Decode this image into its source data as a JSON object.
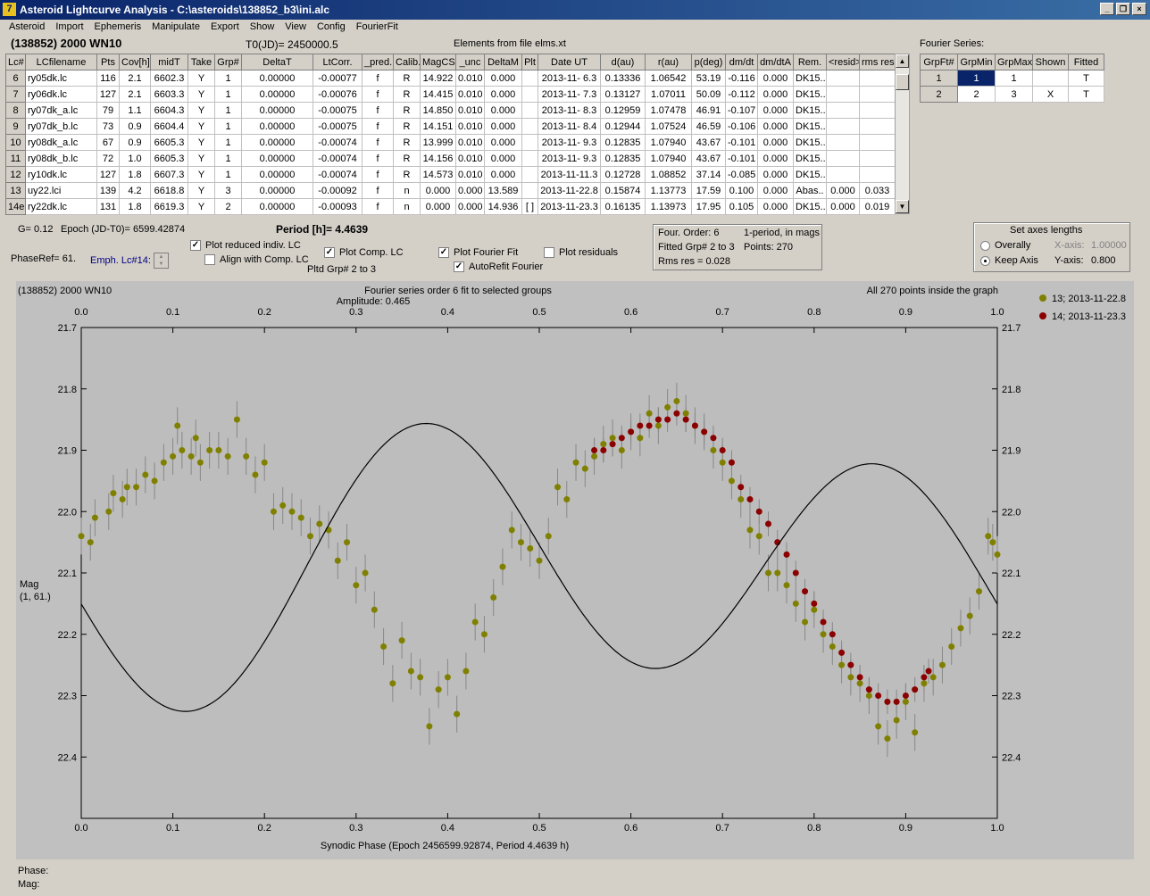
{
  "window": {
    "title": "Asteroid Lightcurve Analysis - C:\\asteroids\\138852_b3\\ini.alc",
    "icon_glyph": "7"
  },
  "menu": [
    "Asteroid",
    "Import",
    "Ephemeris",
    "Manipulate",
    "Export",
    "Show",
    "View",
    "Config",
    "FourierFit"
  ],
  "header": {
    "object": "(138852) 2000 WN10",
    "t0": "T0(JD)= 2450000.5",
    "elements": "Elements from file elms.xt"
  },
  "lc_table": {
    "columns": [
      "Lc#",
      "LCfilename",
      "Pts",
      "Cov[h]",
      "midT",
      "Take",
      "Grp#",
      "DeltaT",
      "LtCorr.",
      "_pred.",
      "Calib.",
      "MagCS",
      "_unc",
      "DeltaM",
      "Plt",
      "Date UT",
      "d(au)",
      "r(au)",
      "p(deg)",
      "dm/dt",
      "dm/dtA",
      "Rem.",
      "<resid>",
      "rms res"
    ],
    "rows": [
      [
        "6",
        "ry05dk.lc",
        "116",
        "2.1",
        "6602.3",
        "Y",
        "1",
        "0.00000",
        "-0.00077",
        "f",
        "R",
        "14.922",
        "0.010",
        "0.000",
        "",
        "2013-11- 6.3",
        "0.13336",
        "1.06542",
        "53.19",
        "-0.116",
        "0.000",
        "DK15..",
        "",
        ""
      ],
      [
        "7",
        "ry06dk.lc",
        "127",
        "2.1",
        "6603.3",
        "Y",
        "1",
        "0.00000",
        "-0.00076",
        "f",
        "R",
        "14.415",
        "0.010",
        "0.000",
        "",
        "2013-11- 7.3",
        "0.13127",
        "1.07011",
        "50.09",
        "-0.112",
        "0.000",
        "DK15..",
        "",
        ""
      ],
      [
        "8",
        "ry07dk_a.lc",
        "79",
        "1.1",
        "6604.3",
        "Y",
        "1",
        "0.00000",
        "-0.00075",
        "f",
        "R",
        "14.850",
        "0.010",
        "0.000",
        "",
        "2013-11- 8.3",
        "0.12959",
        "1.07478",
        "46.91",
        "-0.107",
        "0.000",
        "DK15..",
        "",
        ""
      ],
      [
        "9",
        "ry07dk_b.lc",
        "73",
        "0.9",
        "6604.4",
        "Y",
        "1",
        "0.00000",
        "-0.00075",
        "f",
        "R",
        "14.151",
        "0.010",
        "0.000",
        "",
        "2013-11- 8.4",
        "0.12944",
        "1.07524",
        "46.59",
        "-0.106",
        "0.000",
        "DK15..",
        "",
        ""
      ],
      [
        "10",
        "ry08dk_a.lc",
        "67",
        "0.9",
        "6605.3",
        "Y",
        "1",
        "0.00000",
        "-0.00074",
        "f",
        "R",
        "13.999",
        "0.010",
        "0.000",
        "",
        "2013-11- 9.3",
        "0.12835",
        "1.07940",
        "43.67",
        "-0.101",
        "0.000",
        "DK15..",
        "",
        ""
      ],
      [
        "11",
        "ry08dk_b.lc",
        "72",
        "1.0",
        "6605.3",
        "Y",
        "1",
        "0.00000",
        "-0.00074",
        "f",
        "R",
        "14.156",
        "0.010",
        "0.000",
        "",
        "2013-11- 9.3",
        "0.12835",
        "1.07940",
        "43.67",
        "-0.101",
        "0.000",
        "DK15..",
        "",
        ""
      ],
      [
        "12",
        "ry10dk.lc",
        "127",
        "1.8",
        "6607.3",
        "Y",
        "1",
        "0.00000",
        "-0.00074",
        "f",
        "R",
        "14.573",
        "0.010",
        "0.000",
        "",
        "2013-11-11.3",
        "0.12728",
        "1.08852",
        "37.14",
        "-0.085",
        "0.000",
        "DK15..",
        "",
        ""
      ],
      [
        "13",
        "uy22.lci",
        "139",
        "4.2",
        "6618.8",
        "Y",
        "3",
        "0.00000",
        "-0.00092",
        "f",
        "n",
        "0.000",
        "0.000",
        "13.589",
        "",
        "2013-11-22.8",
        "0.15874",
        "1.13773",
        "17.59",
        "0.100",
        "0.000",
        "Abas..",
        "0.000",
        "0.033"
      ],
      [
        "14e",
        "ry22dk.lc",
        "131",
        "1.8",
        "6619.3",
        "Y",
        "2",
        "0.00000",
        "-0.00093",
        "f",
        "n",
        "0.000",
        "0.000",
        "14.936",
        "[ ]",
        "2013-11-23.3",
        "0.16135",
        "1.13973",
        "17.95",
        "0.105",
        "0.000",
        "DK15..",
        "0.000",
        "0.019"
      ]
    ]
  },
  "fourier_table": {
    "title": "Fourier Series:",
    "columns": [
      "GrpFt#",
      "GrpMin",
      "GrpMax",
      "Shown",
      "Fitted"
    ],
    "rows": [
      [
        "1",
        "1",
        "1",
        "",
        "T"
      ],
      [
        "2",
        "2",
        "3",
        "X",
        "T"
      ]
    ]
  },
  "controls": {
    "g": "G= 0.12",
    "epoch": "Epoch (JD-T0)= 6599.42874",
    "period": "Period [h]= 4.4639",
    "phaseref": "PhaseRef= 61.",
    "emph": "Emph. Lc#14:",
    "plot_reduced": "Plot reduced indiv. LC",
    "align": "Align with Comp. LC",
    "plot_comp": "Plot Comp. LC",
    "pltd_grp": "Pltd Grp#  2  to   3",
    "plot_fourier": "Plot Fourier Fit",
    "autorefit": "AutoRefit Fourier",
    "plot_residuals": "Plot residuals"
  },
  "info": {
    "four_order": "Four. Order:  6",
    "mode": "1-period, in mags",
    "fitted": "Fitted Grp# 2 to 3",
    "points": "Points: 270",
    "rms": "Rms res     = 0.028"
  },
  "axes_box": {
    "title": "Set axes lengths",
    "overall": "Overally",
    "keep": "Keep Axis",
    "xlabel": "X-axis:",
    "xval": "1.00000",
    "ylabel": "Y-axis:",
    "yval": "0.800"
  },
  "status": {
    "phase": "Phase:",
    "mag": "Mag:"
  },
  "chart_data": {
    "type": "scatter",
    "title": "Fourier series order 6 fit to selected groups",
    "subtitle": "Amplitude: 0.465",
    "corner_left": "(138852) 2000 WN10",
    "corner_right": "All 270 points inside the graph",
    "xlabel": "Synodic Phase (Epoch 2456599.92874, Period 4.4639 h)",
    "ylabel": "Mag",
    "ylabel2": "(1, 61.)",
    "xlim": [
      0.0,
      1.0
    ],
    "ylim": [
      21.7,
      22.5
    ],
    "y_inverted": true,
    "xticks": [
      "0.0",
      "0.1",
      "0.2",
      "0.3",
      "0.4",
      "0.5",
      "0.6",
      "0.7",
      "0.8",
      "0.9",
      "1.0"
    ],
    "yticks": [
      "21.7",
      "21.8",
      "21.9",
      "22.0",
      "22.1",
      "22.2",
      "22.3",
      "22.4"
    ],
    "fourier_curve": {
      "mean": 22.09,
      "a1": 0.048,
      "p1": 0.0,
      "a2": 0.2,
      "p2": 0.12,
      "color": "#000000"
    },
    "series": [
      {
        "name": "13; 2013-11-22.8",
        "color": "#808000",
        "err": 0.03,
        "points": [
          [
            0.0,
            22.04
          ],
          [
            0.01,
            22.05
          ],
          [
            0.015,
            22.01
          ],
          [
            0.03,
            22.0
          ],
          [
            0.035,
            21.97
          ],
          [
            0.045,
            21.98
          ],
          [
            0.05,
            21.96
          ],
          [
            0.06,
            21.96
          ],
          [
            0.07,
            21.94
          ],
          [
            0.08,
            21.95
          ],
          [
            0.09,
            21.92
          ],
          [
            0.1,
            21.91
          ],
          [
            0.105,
            21.86
          ],
          [
            0.11,
            21.9
          ],
          [
            0.12,
            21.91
          ],
          [
            0.125,
            21.88
          ],
          [
            0.13,
            21.92
          ],
          [
            0.14,
            21.9
          ],
          [
            0.15,
            21.9
          ],
          [
            0.16,
            21.91
          ],
          [
            0.17,
            21.85
          ],
          [
            0.18,
            21.91
          ],
          [
            0.19,
            21.94
          ],
          [
            0.2,
            21.92
          ],
          [
            0.21,
            22.0
          ],
          [
            0.22,
            21.99
          ],
          [
            0.23,
            22.0
          ],
          [
            0.24,
            22.01
          ],
          [
            0.25,
            22.04
          ],
          [
            0.26,
            22.02
          ],
          [
            0.27,
            22.03
          ],
          [
            0.28,
            22.08
          ],
          [
            0.29,
            22.05
          ],
          [
            0.3,
            22.12
          ],
          [
            0.31,
            22.1
          ],
          [
            0.32,
            22.16
          ],
          [
            0.33,
            22.22
          ],
          [
            0.34,
            22.28
          ],
          [
            0.35,
            22.21
          ],
          [
            0.36,
            22.26
          ],
          [
            0.37,
            22.27
          ],
          [
            0.38,
            22.35
          ],
          [
            0.39,
            22.29
          ],
          [
            0.4,
            22.27
          ],
          [
            0.41,
            22.33
          ],
          [
            0.42,
            22.26
          ],
          [
            0.43,
            22.18
          ],
          [
            0.44,
            22.2
          ],
          [
            0.45,
            22.14
          ],
          [
            0.46,
            22.09
          ],
          [
            0.47,
            22.03
          ],
          [
            0.48,
            22.05
          ],
          [
            0.49,
            22.06
          ],
          [
            0.5,
            22.08
          ],
          [
            0.51,
            22.04
          ],
          [
            0.52,
            21.96
          ],
          [
            0.53,
            21.98
          ],
          [
            0.54,
            21.92
          ],
          [
            0.55,
            21.93
          ],
          [
            0.56,
            21.91
          ],
          [
            0.57,
            21.89
          ],
          [
            0.58,
            21.88
          ],
          [
            0.59,
            21.9
          ],
          [
            0.6,
            21.87
          ],
          [
            0.61,
            21.88
          ],
          [
            0.62,
            21.84
          ],
          [
            0.63,
            21.86
          ],
          [
            0.64,
            21.83
          ],
          [
            0.65,
            21.82
          ],
          [
            0.66,
            21.84
          ],
          [
            0.67,
            21.86
          ],
          [
            0.68,
            21.87
          ],
          [
            0.69,
            21.9
          ],
          [
            0.7,
            21.92
          ],
          [
            0.71,
            21.95
          ],
          [
            0.72,
            21.98
          ],
          [
            0.73,
            22.03
          ],
          [
            0.74,
            22.04
          ],
          [
            0.75,
            22.1
          ],
          [
            0.76,
            22.1
          ],
          [
            0.77,
            22.12
          ],
          [
            0.78,
            22.15
          ],
          [
            0.79,
            22.18
          ],
          [
            0.8,
            22.16
          ],
          [
            0.81,
            22.2
          ],
          [
            0.82,
            22.22
          ],
          [
            0.83,
            22.25
          ],
          [
            0.84,
            22.27
          ],
          [
            0.85,
            22.28
          ],
          [
            0.86,
            22.3
          ],
          [
            0.87,
            22.35
          ],
          [
            0.88,
            22.37
          ],
          [
            0.89,
            22.34
          ],
          [
            0.9,
            22.31
          ],
          [
            0.91,
            22.36
          ],
          [
            0.92,
            22.28
          ],
          [
            0.93,
            22.27
          ],
          [
            0.94,
            22.25
          ],
          [
            0.95,
            22.22
          ],
          [
            0.96,
            22.19
          ],
          [
            0.97,
            22.17
          ],
          [
            0.98,
            22.13
          ],
          [
            0.99,
            22.04
          ],
          [
            0.995,
            22.05
          ],
          [
            1.0,
            22.07
          ]
        ]
      },
      {
        "name": "14; 2013-11-23.3",
        "color": "#8b0000",
        "err": 0.02,
        "points": [
          [
            0.56,
            21.9
          ],
          [
            0.57,
            21.9
          ],
          [
            0.58,
            21.89
          ],
          [
            0.59,
            21.88
          ],
          [
            0.6,
            21.87
          ],
          [
            0.61,
            21.86
          ],
          [
            0.62,
            21.86
          ],
          [
            0.63,
            21.85
          ],
          [
            0.64,
            21.85
          ],
          [
            0.65,
            21.84
          ],
          [
            0.66,
            21.85
          ],
          [
            0.67,
            21.86
          ],
          [
            0.68,
            21.87
          ],
          [
            0.69,
            21.88
          ],
          [
            0.7,
            21.9
          ],
          [
            0.71,
            21.92
          ],
          [
            0.72,
            21.96
          ],
          [
            0.73,
            21.98
          ],
          [
            0.74,
            22.0
          ],
          [
            0.75,
            22.02
          ],
          [
            0.76,
            22.05
          ],
          [
            0.77,
            22.07
          ],
          [
            0.78,
            22.1
          ],
          [
            0.79,
            22.13
          ],
          [
            0.8,
            22.15
          ],
          [
            0.81,
            22.18
          ],
          [
            0.82,
            22.2
          ],
          [
            0.83,
            22.23
          ],
          [
            0.84,
            22.25
          ],
          [
            0.85,
            22.27
          ],
          [
            0.86,
            22.29
          ],
          [
            0.87,
            22.3
          ],
          [
            0.88,
            22.31
          ],
          [
            0.89,
            22.31
          ],
          [
            0.9,
            22.3
          ],
          [
            0.91,
            22.29
          ],
          [
            0.92,
            22.27
          ],
          [
            0.925,
            22.26
          ]
        ]
      }
    ]
  }
}
